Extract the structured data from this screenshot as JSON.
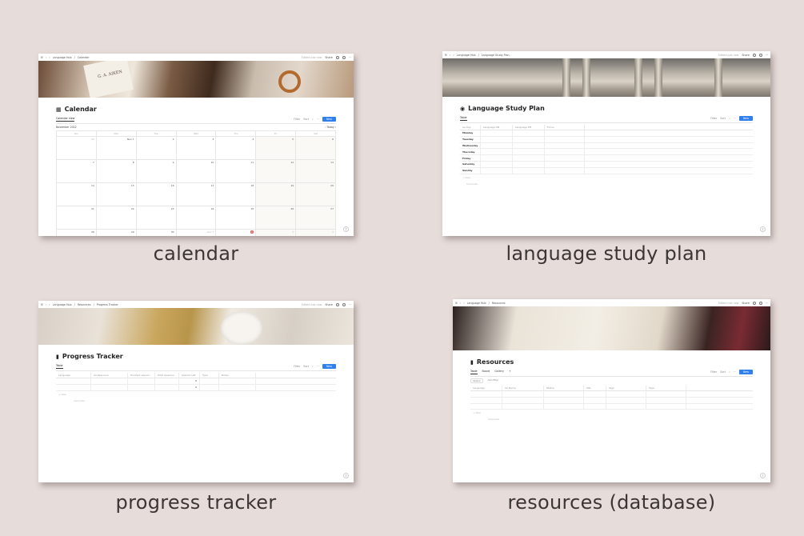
{
  "calendar_shot": {
    "crumbs": [
      "Language Hub",
      "Calendar"
    ],
    "edited": "Edited just now",
    "share": "Share",
    "title": "Calendar",
    "icon": "calendar-icon",
    "view_tab": "Calendar view",
    "tools": [
      "Filter",
      "Sort"
    ],
    "new": "New",
    "month": "November 2022",
    "today_label": "Today",
    "days_of_week": [
      "Sun",
      "Mon",
      "Tue",
      "Wed",
      "Thu",
      "Fri",
      "Sat"
    ],
    "weeks": [
      [
        "30",
        "Nov 1",
        "2",
        "3",
        "4",
        "5",
        "6"
      ],
      [
        "7",
        "8",
        "9",
        "10",
        "11",
        "12",
        "13"
      ],
      [
        "14",
        "15",
        "16",
        "17",
        "18",
        "19",
        "20"
      ],
      [
        "21",
        "22",
        "23",
        "24",
        "25",
        "26",
        "27"
      ],
      [
        "28",
        "29",
        "30",
        "Dec 1",
        "2",
        "3",
        "4"
      ]
    ],
    "today_date": "1",
    "cover_book_text": "G. A. AIKEN"
  },
  "study_plan_shot": {
    "crumbs": [
      "Language Hub",
      "Language Study Plan"
    ],
    "edited": "Edited just now",
    "share": "Share",
    "title": "Language Study Plan",
    "view_tab": "Table",
    "tools": [
      "Filter",
      "Sort"
    ],
    "new": "New",
    "columns": [
      "Aa Day",
      "Language AM",
      "Language PM",
      "Focus"
    ],
    "rows": [
      "Monday",
      "Tuesday",
      "Wednesday",
      "Thursday",
      "Friday",
      "Saturday",
      "Sunday"
    ],
    "new_row": "+ New",
    "calculate": "Calculate"
  },
  "progress_shot": {
    "crumbs": [
      "Language Hub",
      "Resources",
      "Progress Tracker"
    ],
    "edited": "Edited just now",
    "share": "Share",
    "title": "Progress Tracker",
    "view_tab": "Table",
    "tools": [
      "Filter",
      "Sort"
    ],
    "new": "New",
    "columns": [
      "Language",
      "Aa Resource",
      "Finished session",
      "Total sessions",
      "Session left",
      "Type",
      "Notes"
    ],
    "row_values": [
      "0",
      "0"
    ],
    "new_row": "+ New",
    "calculate": "Calculate"
  },
  "resources_shot": {
    "crumbs": [
      "Language Hub",
      "Resources"
    ],
    "edited": "Edited just now",
    "share": "Share",
    "title": "Resources",
    "view_tabs": [
      "Table",
      "Board",
      "Gallery"
    ],
    "tools": [
      "Filter",
      "Sort"
    ],
    "new": "New",
    "filters": [
      "Status",
      "Add filter"
    ],
    "columns": [
      "Language",
      "Aa Name",
      "Status",
      "URL",
      "Tags",
      "Type"
    ],
    "new_row": "+ New",
    "calculate": "Calculate"
  },
  "captions": [
    "calendar",
    "language study plan",
    "progress tracker",
    "resources (database)"
  ]
}
